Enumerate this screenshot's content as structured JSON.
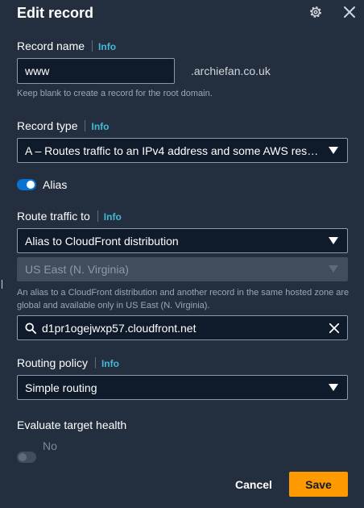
{
  "header": {
    "title": "Edit record"
  },
  "record_name": {
    "label": "Record name",
    "info": "Info",
    "value": "www",
    "domain_suffix": ".archiefan.co.uk",
    "hint": "Keep blank to create a record for the root domain."
  },
  "record_type": {
    "label": "Record type",
    "info": "Info",
    "selected": "A – Routes traffic to an IPv4 address and some AWS resources"
  },
  "alias": {
    "label": "Alias",
    "enabled": true
  },
  "route_traffic": {
    "label": "Route traffic to",
    "info": "Info",
    "endpoint": "Alias to CloudFront distribution",
    "region": "US East (N. Virginia)",
    "hint": "An alias to a CloudFront distribution and another record in the same hosted zone are global and available only in US East (N. Virginia).",
    "target": "d1pr1ogejwxp57.cloudfront.net"
  },
  "routing_policy": {
    "label": "Routing policy",
    "info": "Info",
    "selected": "Simple routing"
  },
  "evaluate_health": {
    "label": "Evaluate target health",
    "toggle_label": "No",
    "enabled": false
  },
  "footer": {
    "cancel": "Cancel",
    "save": "Save"
  },
  "colors": {
    "background": "#232f3e",
    "accent": "#ff9900",
    "link": "#44b9d6",
    "toggle_on": "#0972d3"
  }
}
